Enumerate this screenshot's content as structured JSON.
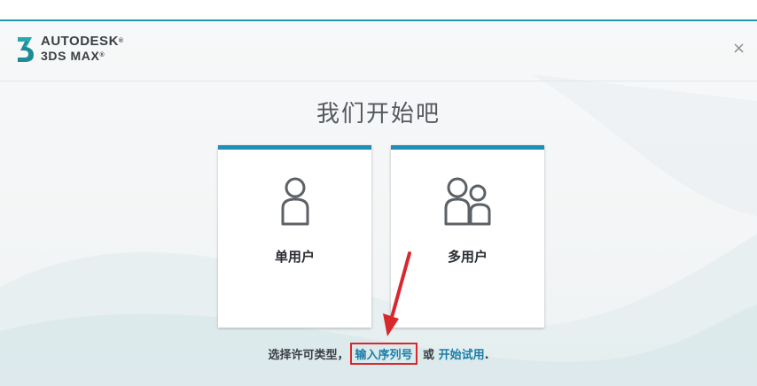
{
  "app": {
    "brand_line1": "AUTODESK",
    "brand_line2": "3DS MAX",
    "registered_mark": "®"
  },
  "dialog": {
    "title": "我们开始吧",
    "close_icon": "close-icon"
  },
  "cards": {
    "single_label": "单用户",
    "multi_label": "多用户"
  },
  "footer": {
    "prefix": "选择许可类型，",
    "serial_link": "输入序列号",
    "or_text": " 或 ",
    "trial_link": "开始试用",
    "suffix": "."
  },
  "colors": {
    "accent": "#1f8fb8",
    "annotation": "#d8272d",
    "link": "#1a7eaa"
  }
}
